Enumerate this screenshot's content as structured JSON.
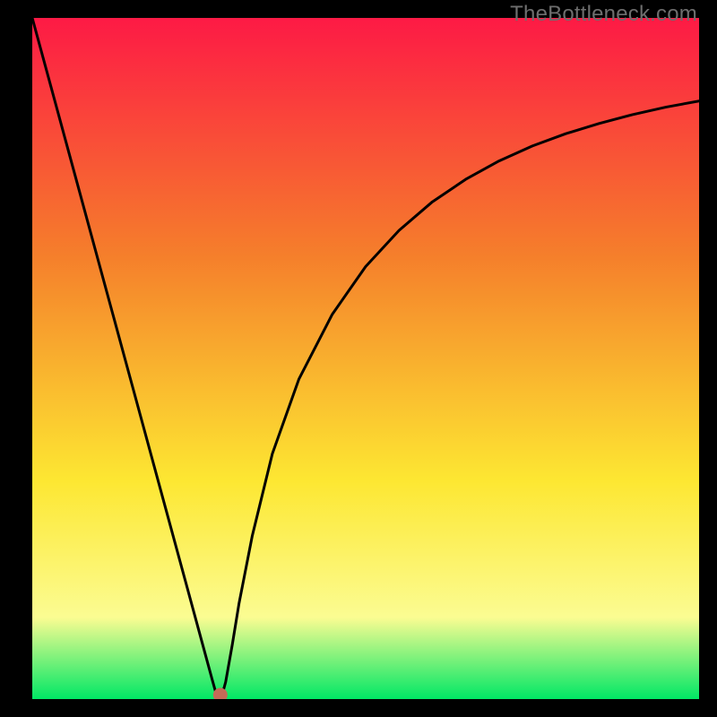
{
  "watermark": "TheBottleneck.com",
  "colors": {
    "bg": "#000000",
    "gradient_top": "#fd1a45",
    "gradient_mid1": "#f57f2b",
    "gradient_mid2": "#fde732",
    "gradient_mid3": "#fbfc92",
    "gradient_bottom": "#00e765",
    "curve": "#000000",
    "marker": "#c46a57"
  },
  "chart_data": {
    "type": "line",
    "title": "",
    "xlabel": "",
    "ylabel": "",
    "xlim": [
      0,
      1
    ],
    "ylim": [
      0,
      1
    ],
    "series": [
      {
        "name": "bottleneck-curve",
        "x": [
          0.0,
          0.05,
          0.1,
          0.15,
          0.2,
          0.23,
          0.255,
          0.27,
          0.278,
          0.283,
          0.29,
          0.3,
          0.31,
          0.33,
          0.36,
          0.4,
          0.45,
          0.5,
          0.55,
          0.6,
          0.65,
          0.7,
          0.75,
          0.8,
          0.85,
          0.9,
          0.95,
          1.0
        ],
        "y": [
          1.0,
          0.82,
          0.64,
          0.46,
          0.28,
          0.172,
          0.082,
          0.028,
          0.0,
          0.0,
          0.025,
          0.08,
          0.14,
          0.24,
          0.36,
          0.47,
          0.565,
          0.635,
          0.688,
          0.73,
          0.763,
          0.79,
          0.812,
          0.83,
          0.845,
          0.858,
          0.869,
          0.878
        ]
      }
    ],
    "annotations": [
      {
        "name": "optimal-marker",
        "x": 0.282,
        "y": 0.006,
        "color_key": "marker",
        "radius_px": 8
      }
    ]
  }
}
